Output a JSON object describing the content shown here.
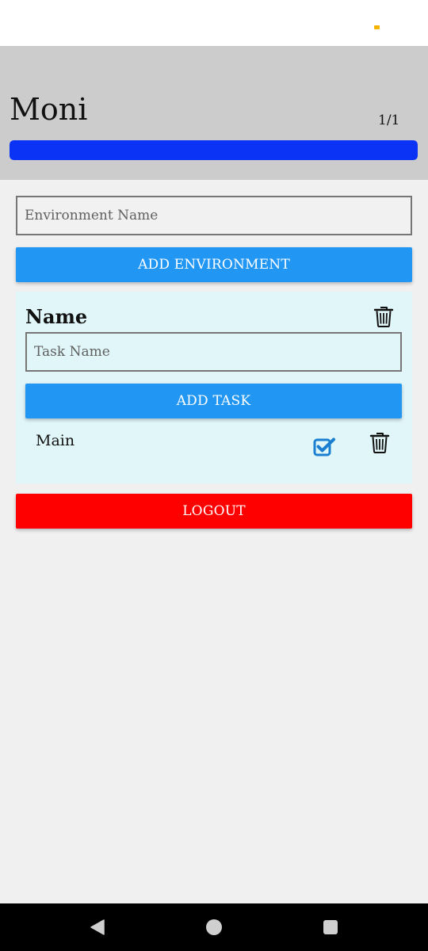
{
  "header": {
    "user_name": "Moni",
    "progress_text": "1/1",
    "progress_fraction": 1.0,
    "progress_color": "#0a33f5"
  },
  "environment_form": {
    "input_placeholder": "Environment Name",
    "input_value": "",
    "add_button_label": "ADD ENVIRONMENT"
  },
  "environments": [
    {
      "name": "Name",
      "delete_icon": "trash-icon",
      "task_input_placeholder": "Task Name",
      "add_task_label": "ADD TASK",
      "tasks": [
        {
          "label": "Main",
          "completed": true,
          "check_icon": "checkbox-checked-icon",
          "delete_icon": "trash-icon"
        }
      ]
    }
  ],
  "logout_label": "LOGOUT",
  "colors": {
    "primary_button": "#2196f3",
    "logout_button": "#ff0000",
    "card_background": "#e0f6f9",
    "header_background": "#cccccc"
  },
  "navigation": {
    "back_icon": "back-triangle-icon",
    "home_icon": "home-circle-icon",
    "recents_icon": "recents-square-icon"
  }
}
